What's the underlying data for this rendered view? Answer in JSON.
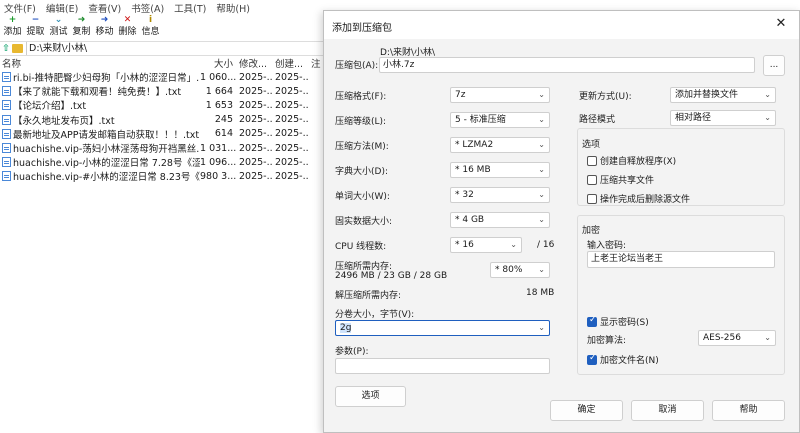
{
  "menu": [
    "文件(F)",
    "编辑(E)",
    "查看(V)",
    "书签(A)",
    "工具(T)",
    "帮助(H)"
  ],
  "toolbar": [
    {
      "label": "添加",
      "icon": "plus-icon",
      "glyph": "+",
      "color": "#1a9a2a"
    },
    {
      "label": "提取",
      "icon": "minus-icon",
      "glyph": "−",
      "color": "#1f4fbf"
    },
    {
      "label": "测试",
      "icon": "check-down-icon",
      "glyph": "⌄",
      "color": "#2a8ab0"
    },
    {
      "label": "复制",
      "icon": "arrow-right-icon",
      "glyph": "➜",
      "color": "#1a8a2a"
    },
    {
      "label": "移动",
      "icon": "arrow-right-icon",
      "glyph": "➜",
      "color": "#1f4fbf"
    },
    {
      "label": "删除",
      "icon": "delete-x-icon",
      "glyph": "✕",
      "color": "#cc1111"
    },
    {
      "label": "信息",
      "icon": "info-icon",
      "glyph": "i",
      "color": "#b08a00"
    }
  ],
  "address": "D:\\来财\\小林\\",
  "columns": {
    "name": "名称",
    "size": "大小",
    "modified": "修改...",
    "created": "创建...",
    "note": "注"
  },
  "files": [
    {
      "name": "ri.bi-推特肥臀少妇母狗「小林的涩涩日常」...",
      "size": "1 060...",
      "modified": "2025-...",
      "created": "2025-..."
    },
    {
      "name": "【来了就能下载和观看！纯免费！】.txt",
      "size": "1 664",
      "modified": "2025-...",
      "created": "2025-..."
    },
    {
      "name": "【论坛介绍】.txt",
      "size": "1 653",
      "modified": "2025-...",
      "created": "2025-..."
    },
    {
      "name": "【永久地址发布页】.txt",
      "size": "245",
      "modified": "2025-...",
      "created": "2025-..."
    },
    {
      "name": "最新地址及APP请发邮箱自动获取！！！.txt",
      "size": "614",
      "modified": "2025-...",
      "created": "2025-..."
    },
    {
      "name": "huachishe.vip-荡妇小林淫荡母狗开裆黑丝...",
      "size": "1 031...",
      "modified": "2025-...",
      "created": "2025-..."
    },
    {
      "name": "huachishe.vip-小林的涩涩日常 7.28号《涩...",
      "size": "1 096...",
      "modified": "2025-...",
      "created": "2025-..."
    },
    {
      "name": "huachishe.vip-#小林的涩涩日常 8.23号《...",
      "size": "980 3...",
      "modified": "2025-...",
      "created": "2025-..."
    }
  ],
  "dialog": {
    "title": "添加到压缩包",
    "archive_label": "压缩包(A):",
    "archive_dir": "D:\\来财\\小林\\",
    "archive_name": "小林.7z",
    "browse_label": "...",
    "format_label": "压缩格式(F):",
    "format_value": "7z",
    "level_label": "压缩等级(L):",
    "level_value": "5 - 标准压缩",
    "method_label": "压缩方法(M):",
    "method_value": "* LZMA2",
    "dict_label": "字典大小(D):",
    "dict_value": "* 16 MB",
    "word_label": "单词大小(W):",
    "word_value": "* 32",
    "solid_label": "固实数据大小:",
    "solid_value": "* 4 GB",
    "cpu_label": "CPU 线程数:",
    "cpu_value": "* 16",
    "cpu_total": "/ 16",
    "mem_comp_label": "压缩所需内存:",
    "mem_comp_value": "2496 MB / 23 GB / 28 GB",
    "mem_percent": "* 80%",
    "mem_decomp_label": "解压缩所需内存:",
    "mem_decomp_value": "18 MB",
    "split_label": "分卷大小，字节(V):",
    "split_value": "2g",
    "params_label": "参数(P):",
    "params_value": "",
    "options_button": "选项",
    "update_label": "更新方式(U):",
    "update_value": "添加并替换文件",
    "pathmode_label": "路径模式",
    "pathmode_value": "相对路径",
    "options_group": "选项",
    "opt_sfx": "创建自释放程序(X)",
    "opt_shared": "压缩共享文件",
    "opt_delete": "操作完成后删除源文件",
    "encrypt_group": "加密",
    "password_label": "输入密码:",
    "password_value": "上老王论坛当老王",
    "show_password": "显示密码(S)",
    "enc_method_label": "加密算法:",
    "enc_method_value": "AES-256",
    "encrypt_names": "加密文件名(N)",
    "ok": "确定",
    "cancel": "取消",
    "help": "帮助"
  }
}
